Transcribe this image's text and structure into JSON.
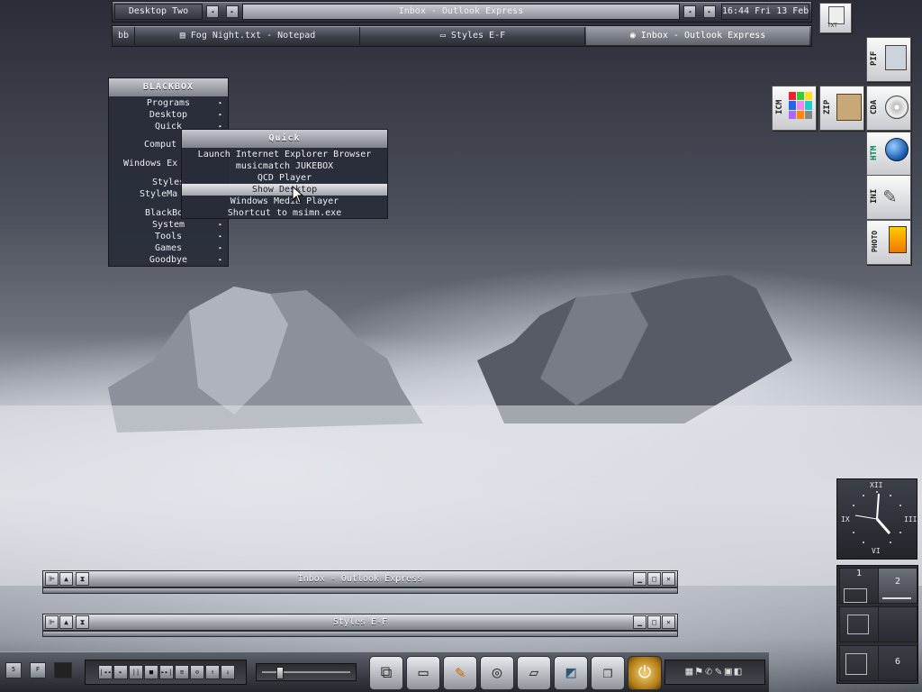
{
  "toolbar": {
    "workspace": "Desktop Two",
    "window_label": "Inbox - Outlook Express",
    "clock": "16:44 Fri 13 Feb"
  },
  "taskbar": {
    "tag": "bb",
    "tasks": [
      {
        "label": "Fog Night.txt - Notepad",
        "icon": "notepad-icon",
        "active": false
      },
      {
        "label": "Styles E-F",
        "icon": "folder-icon",
        "active": false
      },
      {
        "label": "Inbox - Outlook Express",
        "icon": "outlook-icon",
        "active": true
      }
    ]
  },
  "root_menu": {
    "title": "BLACKBOX",
    "items": [
      {
        "label": "Programs",
        "submenu": true
      },
      {
        "label": "Desktop",
        "submenu": true
      },
      {
        "label": "Quick",
        "submenu": true
      },
      {
        "label": "Comput",
        "submenu": false
      },
      {
        "label": "Windows Ex",
        "submenu": false
      },
      {
        "label": "Styles",
        "submenu": false
      },
      {
        "label": "StyleMa",
        "submenu": false
      },
      {
        "label": "BlackBo",
        "submenu": false
      },
      {
        "label": "System",
        "submenu": true
      },
      {
        "label": "Tools",
        "submenu": true
      },
      {
        "label": "Games",
        "submenu": true
      },
      {
        "label": "Goodbye",
        "submenu": true
      }
    ]
  },
  "quick_menu": {
    "title": "Quick",
    "items": [
      {
        "label": "Launch Internet Explorer Browser",
        "selected": false
      },
      {
        "label": "musicmatch JUKEBOX",
        "selected": false
      },
      {
        "label": "QCD Player",
        "selected": false
      },
      {
        "label": "Show Desktop",
        "selected": true
      },
      {
        "label": "Windows Media Player",
        "selected": false
      },
      {
        "label": "Shortcut to msimn.exe",
        "selected": false
      }
    ]
  },
  "desktop_icons": [
    {
      "ext": "TXT",
      "icon": "text-file-icon"
    },
    {
      "ext": "PIF",
      "icon": "pif-file-icon"
    },
    {
      "ext": "ICM",
      "icon": "color-grid-icon"
    },
    {
      "ext": "ZIP",
      "icon": "zip-box-icon"
    },
    {
      "ext": "CDA",
      "icon": "cd-audio-icon"
    },
    {
      "ext": "HTM",
      "icon": "globe-icon"
    },
    {
      "ext": "INI",
      "icon": "wrench-icon"
    },
    {
      "ext": "PHOTO",
      "icon": "film-icon"
    }
  ],
  "clock": {
    "numerals": [
      "XII",
      "III",
      "VI",
      "IX"
    ]
  },
  "windows": [
    {
      "title": "Inbox - Outlook Express"
    },
    {
      "title": "Styles E-F"
    }
  ],
  "pager": {
    "cells": [
      "1",
      "2",
      "",
      "",
      "",
      "6"
    ],
    "active": "2"
  },
  "dock": {
    "left_buttons": [
      "5",
      "F",
      ""
    ],
    "player_buttons": [
      "|◂◂",
      "▸",
      "||",
      "■",
      "▸▸|",
      "≡",
      "⊙",
      "↑",
      "↓"
    ],
    "apps": [
      "disks-icon",
      "drive-icon",
      "tools-icon",
      "film-reel-icon",
      "folder-icon",
      "scanner-icon",
      "files-icon",
      "power-icon"
    ]
  }
}
